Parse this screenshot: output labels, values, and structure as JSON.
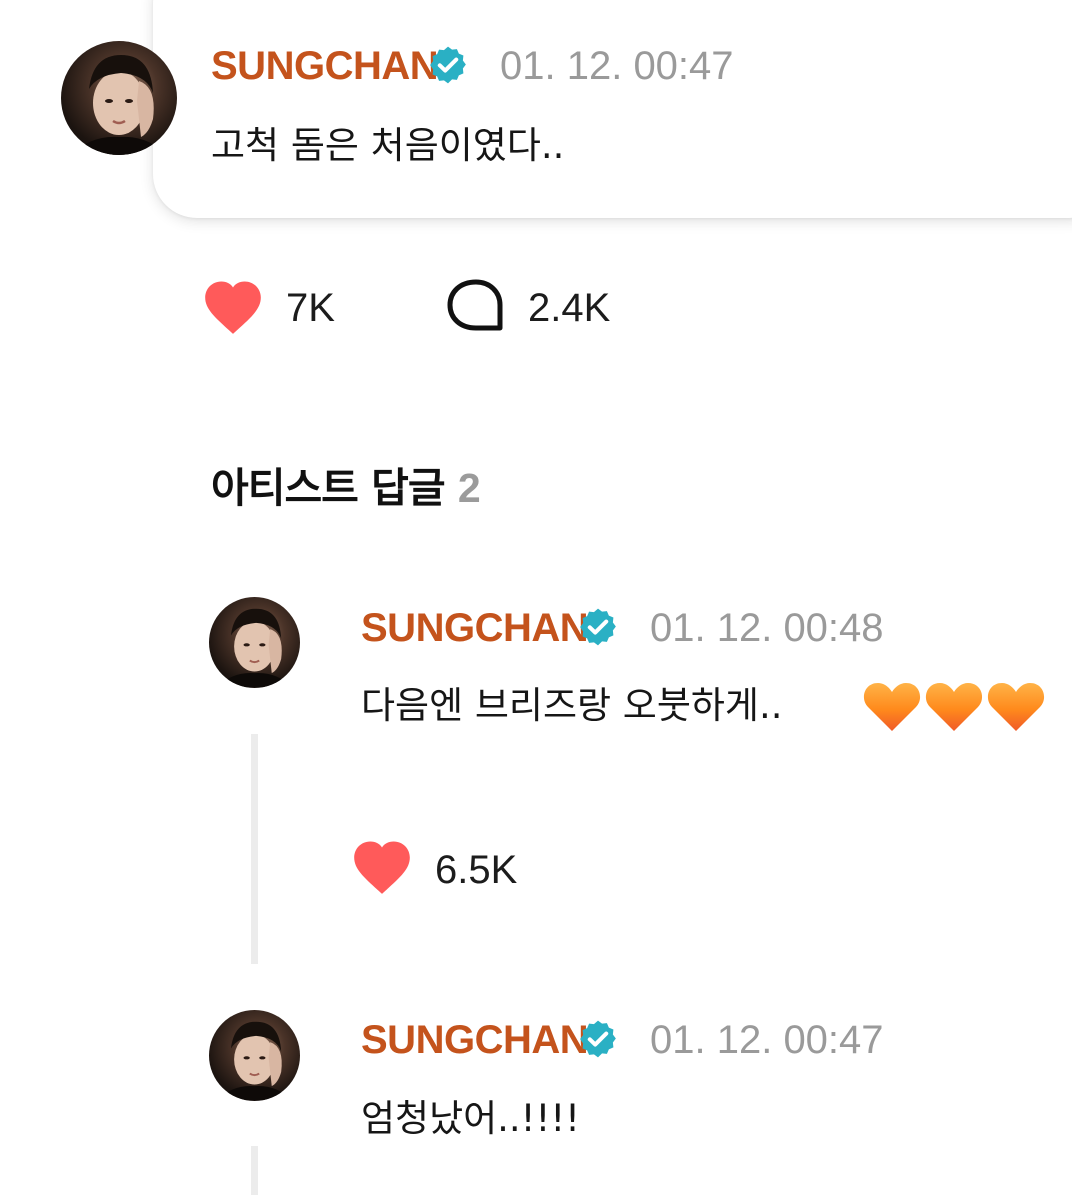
{
  "post": {
    "username": "SUNGCHAN",
    "timestamp": "01. 12. 00:47",
    "text": "고척 돔은 처음이였다..",
    "likes": "7K",
    "comments": "2.4K"
  },
  "replies_section": {
    "title": "아티스트 답글",
    "count": "2"
  },
  "replies": [
    {
      "username": "SUNGCHAN",
      "timestamp": "01. 12. 00:48",
      "text": "다음엔 브리즈랑 오붓하게..",
      "emoji": "🧡🧡🧡",
      "likes": "6.5K"
    },
    {
      "username": "SUNGCHAN",
      "timestamp": "01. 12. 00:47",
      "text": "엄청났어..!!!!"
    }
  ],
  "colors": {
    "username": "#c4531c",
    "verified_badge": "#2ab0c4",
    "heart": "#ff5a5a",
    "timestamp": "#9a9a9a",
    "section_count": "#9b9b9b"
  },
  "icons": {
    "verified": "verified-badge-icon",
    "like": "heart-icon",
    "comment": "comment-bubble-icon",
    "reply_emoji": "orange-heart-emoji"
  }
}
